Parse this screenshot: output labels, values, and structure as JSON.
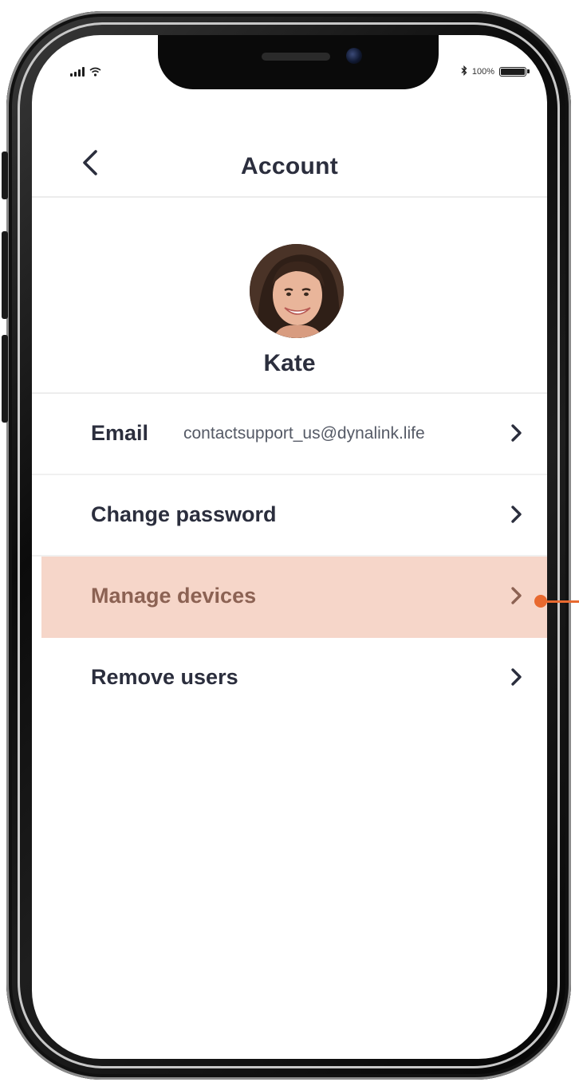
{
  "status_bar": {
    "battery_text": "100%",
    "battery_level": 1.0,
    "icons": [
      "signal-icon",
      "wifi-icon",
      "bluetooth-icon",
      "battery-icon"
    ]
  },
  "header": {
    "title": "Account",
    "back_icon": "chevron-left-icon"
  },
  "profile": {
    "name": "Kate",
    "avatar": "avatar-photo"
  },
  "menu": {
    "items": [
      {
        "label": "Email",
        "value": "contactsupport_us@dynalink.life",
        "icon": "chevron-right-icon"
      },
      {
        "label": "Change password",
        "icon": "chevron-right-icon"
      },
      {
        "label": "Manage devices",
        "icon": "chevron-right-icon",
        "highlighted": true
      },
      {
        "label": "Remove users",
        "icon": "chevron-right-icon"
      }
    ]
  },
  "colors": {
    "text_primary": "#2b2e3d",
    "highlight_bg": "#f6d6c9",
    "highlight_text": "#8c6253",
    "callout_accent": "#e8692f",
    "divider": "#ececec"
  }
}
